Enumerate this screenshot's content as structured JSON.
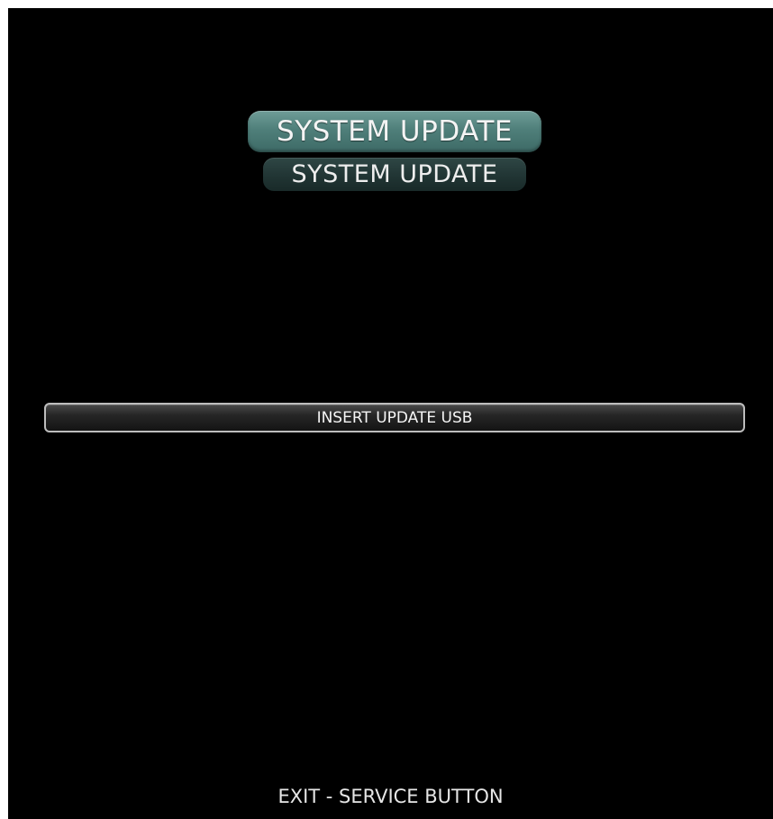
{
  "header": {
    "title_primary": "SYSTEM UPDATE",
    "title_secondary": "SYSTEM UPDATE"
  },
  "status": {
    "message": "INSERT UPDATE USB"
  },
  "footer": {
    "hint": "EXIT - SERVICE BUTTON"
  },
  "colors": {
    "background": "#000000",
    "title_primary_bg": "#4f7f7a",
    "title_secondary_bg": "#213534",
    "status_border": "#bdbdbd"
  }
}
